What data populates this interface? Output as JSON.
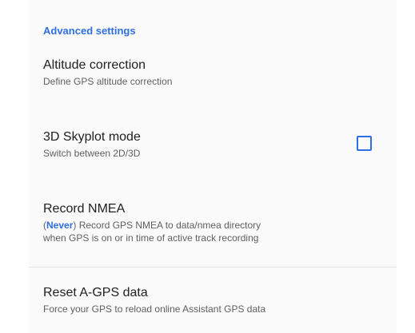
{
  "section": {
    "header": "Advanced settings"
  },
  "prefs": {
    "altitude": {
      "title": "Altitude correction",
      "summary": "Define GPS altitude correction"
    },
    "skyplot": {
      "title": "3D Skyplot mode",
      "summary": "Switch between 2D/3D",
      "checked": false
    },
    "nmea": {
      "title": "Record NMEA",
      "summary_prefix": "(",
      "summary_value": "Never",
      "summary_suffix": ") Record GPS NMEA to data/nmea directory",
      "summary_line2": "when GPS is on or in time of active track recording"
    },
    "agps": {
      "title": "Reset A-GPS data",
      "summary": "Force your GPS to reload online Assistant GPS data"
    }
  },
  "colors": {
    "accent": "#2f6fe4",
    "title_text": "#212121",
    "summary_text": "#5f5f5f"
  }
}
